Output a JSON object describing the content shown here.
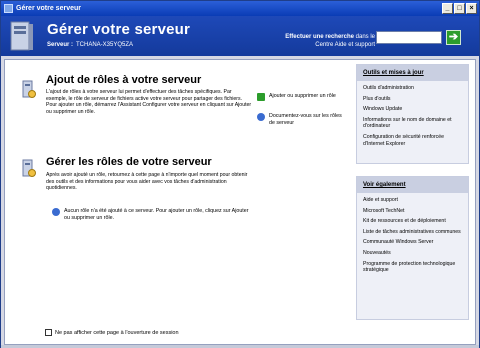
{
  "window": {
    "title": "Gérer votre serveur",
    "min": "_",
    "max": "□",
    "close": "×"
  },
  "header": {
    "title": "Gérer votre serveur",
    "server_label": "Serveur :",
    "server_name": "TCHANA-X35YQ5ZA",
    "search_bold": "Effectuer une recherche",
    "search_rest": " dans le",
    "search_line2": "Centre Aide et support",
    "search_placeholder": "",
    "go_symbol": "➔"
  },
  "sections": [
    {
      "title": "Ajout de rôles à votre serveur",
      "text": "L'ajout de rôles à votre serveur lui permet d'effectuer des tâches spécifiques. Par exemple, le rôle de serveur de fichiers active votre serveur pour partager des fichiers. Pour ajouter un rôle, démarrez l'Assistant Configurer votre serveur en cliquant sur Ajouter ou supprimer un rôle.",
      "actions": [
        "Ajouter ou supprimer un rôle",
        "Documentez-vous sur les rôles de serveur"
      ]
    },
    {
      "title": "Gérer les rôles de votre serveur",
      "text": "Après avoir ajouté un rôle, retournez à cette page à n'importe quel moment pour obtenir des outils et des informations pour vous aider avec vos tâches d'administration quotidiennes.",
      "note": "Aucun rôle n'a été ajouté à ce serveur. Pour ajouter un rôle, cliquez sur Ajouter ou supprimer un rôle."
    }
  ],
  "sidebar": {
    "tools_title": "Outils et mises à jour",
    "tools": [
      "Outils d'administration",
      "Plus d'outils",
      "Windows Update",
      "Informations sur le nom de domaine et d'ordinateur",
      "Configuration de sécurité renforcée d'Internet Explorer"
    ],
    "see_title": "Voir également",
    "see": [
      "Aide et support",
      "Microsoft TechNet",
      "Kit de ressources et de déploiement",
      "Liste de tâches administratives communes",
      "Communauté Windows Server",
      "Nouveautés",
      "Programme de protection technologique stratégique"
    ]
  },
  "footer": {
    "checkbox_label": "Ne pas afficher cette page à l'ouverture de session"
  }
}
